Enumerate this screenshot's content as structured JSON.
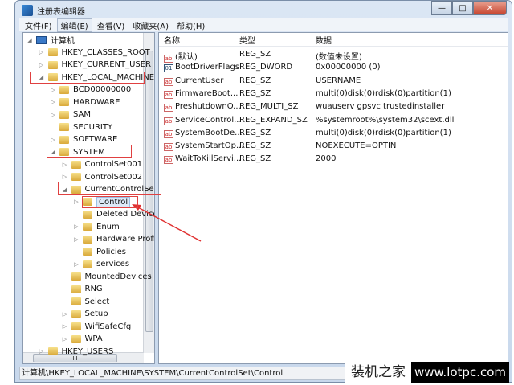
{
  "window": {
    "title": "注册表编辑器",
    "minimize": "—",
    "maximize": "□",
    "close": "✕"
  },
  "menu": [
    {
      "label": "文件(F)"
    },
    {
      "label": "编辑(E)",
      "active": true
    },
    {
      "label": "查看(V)"
    },
    {
      "label": "收藏夹(A)"
    },
    {
      "label": "帮助(H)"
    }
  ],
  "tree": [
    {
      "label": "计算机",
      "level": 0,
      "exp": "◢",
      "type": "pc"
    },
    {
      "label": "HKEY_CLASSES_ROOT",
      "level": 1,
      "exp": "▷"
    },
    {
      "label": "HKEY_CURRENT_USER",
      "level": 1,
      "exp": "▷"
    },
    {
      "label": "HKEY_LOCAL_MACHINE",
      "level": 1,
      "exp": "◢",
      "highlight": true
    },
    {
      "label": "BCD00000000",
      "level": 2,
      "exp": "▷"
    },
    {
      "label": "HARDWARE",
      "level": 2,
      "exp": "▷"
    },
    {
      "label": "SAM",
      "level": 2,
      "exp": "▷"
    },
    {
      "label": "SECURITY",
      "level": 2,
      "exp": ""
    },
    {
      "label": "SOFTWARE",
      "level": 2,
      "exp": "▷"
    },
    {
      "label": "SYSTEM",
      "level": 2,
      "exp": "◢",
      "highlight": true
    },
    {
      "label": "ControlSet001",
      "level": 3,
      "exp": "▷"
    },
    {
      "label": "ControlSet002",
      "level": 3,
      "exp": "▷"
    },
    {
      "label": "CurrentControlSet",
      "level": 3,
      "exp": "◢",
      "highlight": true
    },
    {
      "label": "Control",
      "level": 4,
      "exp": "▷",
      "selected": true,
      "highlight": true
    },
    {
      "label": "Deleted Device",
      "level": 4,
      "exp": ""
    },
    {
      "label": "Enum",
      "level": 4,
      "exp": "▷"
    },
    {
      "label": "Hardware Profiles",
      "level": 4,
      "exp": "▷"
    },
    {
      "label": "Policies",
      "level": 4,
      "exp": ""
    },
    {
      "label": "services",
      "level": 4,
      "exp": "▷"
    },
    {
      "label": "MountedDevices",
      "level": 3,
      "exp": ""
    },
    {
      "label": "RNG",
      "level": 3,
      "exp": ""
    },
    {
      "label": "Select",
      "level": 3,
      "exp": ""
    },
    {
      "label": "Setup",
      "level": 3,
      "exp": "▷"
    },
    {
      "label": "WifiSafeCfg",
      "level": 3,
      "exp": "▷"
    },
    {
      "label": "WPA",
      "level": 3,
      "exp": "▷"
    },
    {
      "label": "HKEY_USERS",
      "level": 1,
      "exp": "▷"
    }
  ],
  "list": {
    "headers": {
      "name": "名称",
      "type": "类型",
      "data": "数据"
    },
    "rows": [
      {
        "name": "(默认)",
        "type": "REG_SZ",
        "data": "(数值未设置)",
        "icon": "ab"
      },
      {
        "name": "BootDriverFlags",
        "type": "REG_DWORD",
        "data": "0x00000000 (0)",
        "icon": "bin"
      },
      {
        "name": "CurrentUser",
        "type": "REG_SZ",
        "data": "USERNAME",
        "icon": "ab"
      },
      {
        "name": "FirmwareBoot...",
        "type": "REG_SZ",
        "data": "multi(0)disk(0)rdisk(0)partition(1)",
        "icon": "ab"
      },
      {
        "name": "PreshutdownO...",
        "type": "REG_MULTI_SZ",
        "data": "wuauserv gpsvc trustedinstaller",
        "icon": "ab"
      },
      {
        "name": "ServiceControl...",
        "type": "REG_EXPAND_SZ",
        "data": "%systemroot%\\system32\\scext.dll",
        "icon": "ab"
      },
      {
        "name": "SystemBootDe...",
        "type": "REG_SZ",
        "data": "multi(0)disk(0)rdisk(0)partition(1)",
        "icon": "ab"
      },
      {
        "name": "SystemStartOp...",
        "type": "REG_SZ",
        "data": " NOEXECUTE=OPTIN",
        "icon": "ab"
      },
      {
        "name": "WaitToKillServi...",
        "type": "REG_SZ",
        "data": "2000",
        "icon": "ab"
      }
    ]
  },
  "status": "计算机\\HKEY_LOCAL_MACHINE\\SYSTEM\\CurrentControlSet\\Control",
  "watermark": {
    "cn": "装机之家",
    "url": "www.lotpc.com"
  },
  "hscroll_grip": "III"
}
